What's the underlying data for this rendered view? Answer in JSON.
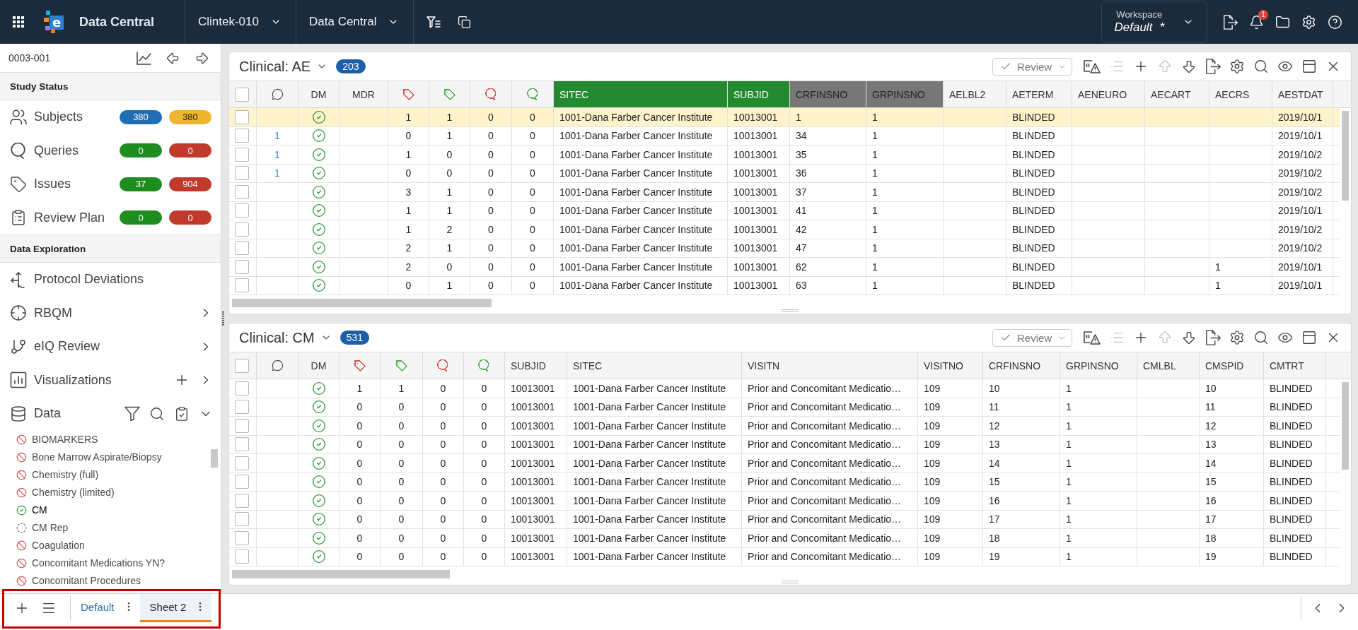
{
  "top_bar": {
    "logo_mark": "e",
    "app_title": "Data Central",
    "menus": [
      "Clintek-010",
      "Data Central"
    ],
    "workspace": {
      "caption": "Workspace",
      "name": "Default",
      "modified_mark": "*"
    },
    "notification_count": "1"
  },
  "sidebar": {
    "record": "0003-001",
    "study_status": {
      "title": "Study Status",
      "items": [
        {
          "kind": "subjects",
          "label": "Subjects",
          "badges": [
            {
              "text": "380",
              "color": "#1f6db3"
            },
            {
              "text": "380",
              "color": "#f0b52e"
            }
          ]
        },
        {
          "kind": "queries",
          "label": "Queries",
          "badges": [
            {
              "text": "0",
              "color": "#1e8c1e"
            },
            {
              "text": "0",
              "color": "#c0392b"
            }
          ]
        },
        {
          "kind": "issues",
          "label": "Issues",
          "badges": [
            {
              "text": "37",
              "color": "#1e8c1e"
            },
            {
              "text": "904",
              "color": "#c0392b"
            }
          ]
        },
        {
          "kind": "review-plan",
          "label": "Review Plan",
          "badges": [
            {
              "text": "0",
              "color": "#1e8c1e"
            },
            {
              "text": "0",
              "color": "#c0392b"
            }
          ]
        }
      ]
    },
    "data_exploration": {
      "title": "Data Exploration",
      "items": [
        {
          "kind": "deviations",
          "label": "Protocol Deviations"
        },
        {
          "kind": "rbqm",
          "label": "RBQM",
          "expanded": false
        },
        {
          "kind": "review",
          "label": "eIQ Review",
          "expanded": false
        },
        {
          "kind": "visualizations",
          "label": "Visualizations",
          "expanded": false,
          "addable": true
        },
        {
          "kind": "data",
          "label": "Data",
          "expanded": true,
          "has_tools": true
        }
      ]
    },
    "datasets": [
      {
        "label": "BIOMARKERS",
        "kind": "excluded",
        "selected": false
      },
      {
        "label": "Bone Marrow Aspirate/Biopsy",
        "kind": "excluded",
        "selected": false
      },
      {
        "label": "Chemistry (full)",
        "kind": "excluded",
        "selected": false
      },
      {
        "label": "Chemistry (limited)",
        "kind": "excluded",
        "selected": false
      },
      {
        "label": "CM",
        "kind": "complete",
        "selected": true
      },
      {
        "label": "CM Rep",
        "kind": "partial",
        "selected": false
      },
      {
        "label": "Coagulation",
        "kind": "excluded",
        "selected": false
      },
      {
        "label": "Concomitant Medications YN?",
        "kind": "excluded",
        "selected": false
      },
      {
        "label": "Concomitant Procedures",
        "kind": "excluded",
        "selected": false
      }
    ]
  },
  "panels": [
    {
      "title": "Clinical: AE",
      "count": "203",
      "review_label": "Review",
      "select_all": false,
      "tools": [
        {
          "kind": "flag",
          "disabled": false
        },
        {
          "kind": "list",
          "disabled": true
        },
        {
          "kind": "add",
          "disabled": false
        },
        {
          "kind": "up",
          "disabled": true
        },
        {
          "kind": "down",
          "disabled": false
        },
        {
          "kind": "export",
          "disabled": false
        },
        {
          "kind": "settings",
          "disabled": false
        },
        {
          "kind": "search",
          "disabled": false
        },
        {
          "kind": "visibility",
          "disabled": false
        },
        {
          "kind": "layout",
          "disabled": false
        },
        {
          "kind": "close",
          "disabled": false
        }
      ],
      "columns": [
        {
          "kind": "select"
        },
        {
          "kind": "comment"
        },
        {
          "kind": "status",
          "label": "DM"
        },
        {
          "kind": "status",
          "label": "MDR"
        },
        {
          "kind": "tag",
          "color": "#d9534f"
        },
        {
          "kind": "tag",
          "color": "#4caf50"
        },
        {
          "kind": "query",
          "color": "#d9534f"
        },
        {
          "kind": "query",
          "color": "#4caf50"
        },
        {
          "kind": "text",
          "label": "SITEC",
          "color": "#238a2f"
        },
        {
          "kind": "text",
          "label": "SUBJID",
          "color": "#238a2f"
        },
        {
          "kind": "text",
          "label": "CRFINSNO",
          "color": "#777777"
        },
        {
          "kind": "text",
          "label": "GRPINSNO",
          "color": "#777777"
        },
        {
          "kind": "text",
          "label": "AELBL2"
        },
        {
          "kind": "text",
          "label": "AETERM"
        },
        {
          "kind": "text",
          "label": "AENEURO"
        },
        {
          "kind": "text",
          "label": "AECART"
        },
        {
          "kind": "text",
          "label": "AECRS"
        },
        {
          "kind": "text",
          "label": "AESTDAT"
        }
      ],
      "rows": [
        {
          "selected": true,
          "cells": [
            false,
            null,
            true,
            null,
            "1",
            "1",
            "0",
            "0",
            "1001-Dana Farber Cancer Institute",
            "10013001",
            "1",
            "1",
            null,
            "BLINDED",
            null,
            null,
            null,
            "2019/10/1"
          ]
        },
        {
          "selected": false,
          "cells": [
            false,
            "1",
            true,
            null,
            "0",
            "1",
            "0",
            "0",
            "1001-Dana Farber Cancer Institute",
            "10013001",
            "34",
            "1",
            null,
            "BLINDED",
            null,
            null,
            null,
            "2019/10/1"
          ]
        },
        {
          "selected": false,
          "cells": [
            false,
            "1",
            true,
            null,
            "1",
            "0",
            "0",
            "0",
            "1001-Dana Farber Cancer Institute",
            "10013001",
            "35",
            "1",
            null,
            "BLINDED",
            null,
            null,
            null,
            "2019/10/2"
          ]
        },
        {
          "selected": false,
          "cells": [
            false,
            "1",
            true,
            null,
            "0",
            "0",
            "0",
            "0",
            "1001-Dana Farber Cancer Institute",
            "10013001",
            "36",
            "1",
            null,
            "BLINDED",
            null,
            null,
            null,
            "2019/10/2"
          ]
        },
        {
          "selected": false,
          "cells": [
            false,
            null,
            true,
            null,
            "3",
            "1",
            "0",
            "0",
            "1001-Dana Farber Cancer Institute",
            "10013001",
            "37",
            "1",
            null,
            "BLINDED",
            null,
            null,
            null,
            "2019/10/2"
          ]
        },
        {
          "selected": false,
          "cells": [
            false,
            null,
            true,
            null,
            "1",
            "1",
            "0",
            "0",
            "1001-Dana Farber Cancer Institute",
            "10013001",
            "41",
            "1",
            null,
            "BLINDED",
            null,
            null,
            null,
            "2019/10/1"
          ]
        },
        {
          "selected": false,
          "cells": [
            false,
            null,
            true,
            null,
            "1",
            "2",
            "0",
            "0",
            "1001-Dana Farber Cancer Institute",
            "10013001",
            "42",
            "1",
            null,
            "BLINDED",
            null,
            null,
            null,
            "2019/10/2"
          ]
        },
        {
          "selected": false,
          "cells": [
            false,
            null,
            true,
            null,
            "2",
            "1",
            "0",
            "0",
            "1001-Dana Farber Cancer Institute",
            "10013001",
            "47",
            "1",
            null,
            "BLINDED",
            null,
            null,
            null,
            "2019/10/2"
          ]
        },
        {
          "selected": false,
          "cells": [
            false,
            null,
            true,
            null,
            "2",
            "0",
            "0",
            "0",
            "1001-Dana Farber Cancer Institute",
            "10013001",
            "62",
            "1",
            null,
            "BLINDED",
            null,
            null,
            "1",
            "2019/10/1"
          ]
        },
        {
          "selected": false,
          "cells": [
            false,
            null,
            true,
            null,
            "0",
            "1",
            "0",
            "0",
            "1001-Dana Farber Cancer Institute",
            "10013001",
            "63",
            "1",
            null,
            "BLINDED",
            null,
            null,
            "1",
            "2019/10/1"
          ]
        }
      ]
    },
    {
      "title": "Clinical: CM",
      "count": "531",
      "review_label": "Review",
      "select_all": false,
      "tools": [
        {
          "kind": "flag",
          "disabled": false
        },
        {
          "kind": "list",
          "disabled": true
        },
        {
          "kind": "add",
          "disabled": false
        },
        {
          "kind": "up",
          "disabled": true
        },
        {
          "kind": "down",
          "disabled": false
        },
        {
          "kind": "export",
          "disabled": false
        },
        {
          "kind": "settings",
          "disabled": false
        },
        {
          "kind": "search",
          "disabled": false
        },
        {
          "kind": "visibility",
          "disabled": false
        },
        {
          "kind": "layout",
          "disabled": false
        },
        {
          "kind": "close",
          "disabled": false
        }
      ],
      "columns": [
        {
          "kind": "select"
        },
        {
          "kind": "comment"
        },
        {
          "kind": "status",
          "label": "DM"
        },
        {
          "kind": "tag",
          "color": "#d9534f"
        },
        {
          "kind": "tag",
          "color": "#4caf50"
        },
        {
          "kind": "query",
          "color": "#d9534f"
        },
        {
          "kind": "query",
          "color": "#4caf50"
        },
        {
          "kind": "text",
          "label": "SUBJID"
        },
        {
          "kind": "text",
          "label": "SITEC"
        },
        {
          "kind": "text",
          "label": "VISITN"
        },
        {
          "kind": "text",
          "label": "VISITNO"
        },
        {
          "kind": "text",
          "label": "CRFINSNO"
        },
        {
          "kind": "text",
          "label": "GRPINSNO"
        },
        {
          "kind": "text",
          "label": "CMLBL"
        },
        {
          "kind": "text",
          "label": "CMSPID"
        },
        {
          "kind": "text",
          "label": "CMTRT"
        }
      ],
      "rows": [
        {
          "selected": false,
          "cells": [
            false,
            null,
            true,
            "1",
            "1",
            "0",
            "0",
            "10013001",
            "1001-Dana Farber Cancer Institute",
            "Prior and Concomitant Medicatio…",
            "109",
            "10",
            "1",
            null,
            "10",
            "BLINDED"
          ]
        },
        {
          "selected": false,
          "cells": [
            false,
            null,
            true,
            "0",
            "0",
            "0",
            "0",
            "10013001",
            "1001-Dana Farber Cancer Institute",
            "Prior and Concomitant Medicatio…",
            "109",
            "11",
            "1",
            null,
            "11",
            "BLINDED"
          ]
        },
        {
          "selected": false,
          "cells": [
            false,
            null,
            true,
            "0",
            "0",
            "0",
            "0",
            "10013001",
            "1001-Dana Farber Cancer Institute",
            "Prior and Concomitant Medicatio…",
            "109",
            "12",
            "1",
            null,
            "12",
            "BLINDED"
          ]
        },
        {
          "selected": false,
          "cells": [
            false,
            null,
            true,
            "0",
            "0",
            "0",
            "0",
            "10013001",
            "1001-Dana Farber Cancer Institute",
            "Prior and Concomitant Medicatio…",
            "109",
            "13",
            "1",
            null,
            "13",
            "BLINDED"
          ]
        },
        {
          "selected": false,
          "cells": [
            false,
            null,
            true,
            "0",
            "0",
            "0",
            "0",
            "10013001",
            "1001-Dana Farber Cancer Institute",
            "Prior and Concomitant Medicatio…",
            "109",
            "14",
            "1",
            null,
            "14",
            "BLINDED"
          ]
        },
        {
          "selected": false,
          "cells": [
            false,
            null,
            true,
            "0",
            "0",
            "0",
            "0",
            "10013001",
            "1001-Dana Farber Cancer Institute",
            "Prior and Concomitant Medicatio…",
            "109",
            "15",
            "1",
            null,
            "15",
            "BLINDED"
          ]
        },
        {
          "selected": false,
          "cells": [
            false,
            null,
            true,
            "0",
            "0",
            "0",
            "0",
            "10013001",
            "1001-Dana Farber Cancer Institute",
            "Prior and Concomitant Medicatio…",
            "109",
            "16",
            "1",
            null,
            "16",
            "BLINDED"
          ]
        },
        {
          "selected": false,
          "cells": [
            false,
            null,
            true,
            "0",
            "0",
            "0",
            "0",
            "10013001",
            "1001-Dana Farber Cancer Institute",
            "Prior and Concomitant Medicatio…",
            "109",
            "17",
            "1",
            null,
            "17",
            "BLINDED"
          ]
        },
        {
          "selected": false,
          "cells": [
            false,
            null,
            true,
            "0",
            "0",
            "0",
            "0",
            "10013001",
            "1001-Dana Farber Cancer Institute",
            "Prior and Concomitant Medicatio…",
            "109",
            "18",
            "1",
            null,
            "18",
            "BLINDED"
          ]
        },
        {
          "selected": false,
          "cells": [
            false,
            null,
            true,
            "0",
            "0",
            "0",
            "0",
            "10013001",
            "1001-Dana Farber Cancer Institute",
            "Prior and Concomitant Medicatio…",
            "109",
            "19",
            "1",
            null,
            "19",
            "BLINDED"
          ]
        }
      ]
    }
  ],
  "sheets": [
    {
      "label": "Default",
      "selected": false
    },
    {
      "label": "Sheet 2",
      "selected": true
    }
  ]
}
